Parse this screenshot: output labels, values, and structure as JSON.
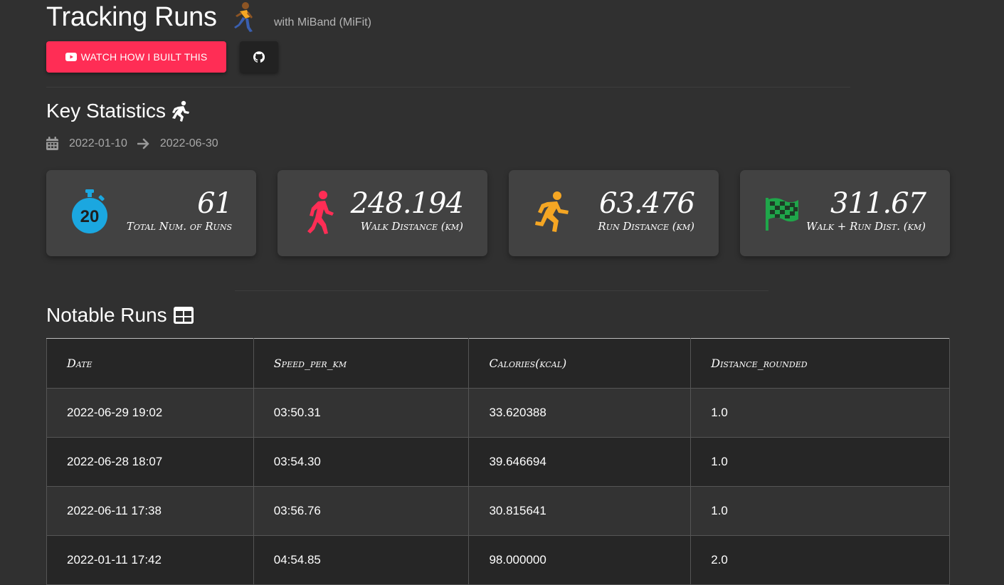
{
  "header": {
    "title": "Tracking Runs",
    "title_icon": "runner-icon",
    "subtitle": "with MiBand (MiFit)",
    "watch_button": {
      "label": "WATCH HOW I BUILT THIS",
      "icon": "youtube-icon"
    },
    "github_button": {
      "icon": "github-icon"
    }
  },
  "key_statistics": {
    "title": "Key Statistics",
    "title_icon": "running-man-icon",
    "date_from": "2022-01-10",
    "date_to": "2022-06-30",
    "cards": [
      {
        "icon": "stopwatch-icon",
        "value": "61",
        "label": "Total Num. of Runs",
        "icon_color": "#1ba7e0"
      },
      {
        "icon": "walking-icon",
        "value": "248.194",
        "label": "Walk Distance (km)",
        "icon_color": "#ff2d55"
      },
      {
        "icon": "running-icon",
        "value": "63.476",
        "label": "Run Distance (km)",
        "icon_color": "#f5a623"
      },
      {
        "icon": "checkered-flag-icon",
        "value": "311.67",
        "label": "Walk + Run Dist. (km)",
        "icon_color": "#1fa64a"
      }
    ]
  },
  "notable_runs": {
    "title": "Notable Runs",
    "title_icon": "table-icon",
    "columns": [
      "Date",
      "Speed_per_km",
      "Calories(kcal)",
      "Distance_rounded"
    ],
    "rows": [
      [
        "2022-06-29 19:02",
        "03:50.31",
        "33.620388",
        "1.0"
      ],
      [
        "2022-06-28 18:07",
        "03:54.30",
        "39.646694",
        "1.0"
      ],
      [
        "2022-06-11 17:38",
        "03:56.76",
        "30.815641",
        "1.0"
      ],
      [
        "2022-01-11 17:42",
        "04:54.85",
        "98.000000",
        "2.0"
      ]
    ]
  },
  "colors": {
    "background": "#303030",
    "accent": "#ff2d55",
    "card": "#424242"
  }
}
